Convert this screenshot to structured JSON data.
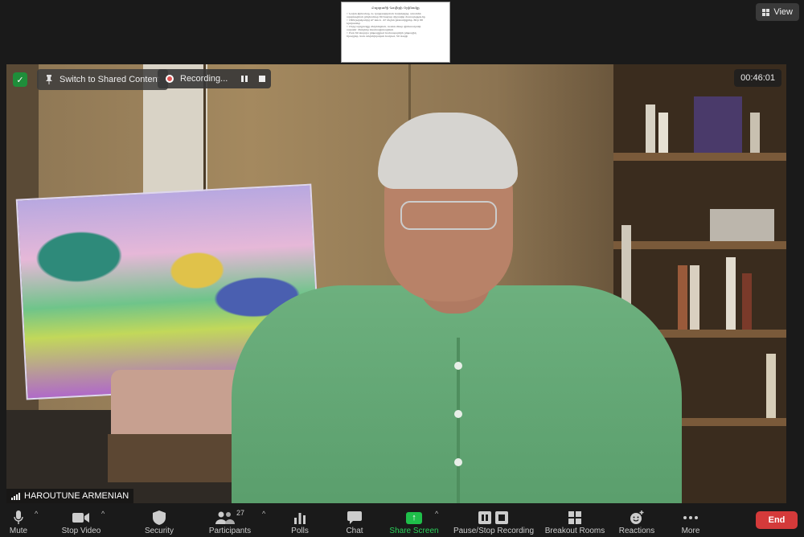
{
  "share_thumbnail": {
    "title": "Բոլորածի Գովերի Օրինակը",
    "lines": [
      "• Նախո ֆինանսը, ու կարգավորման նախորդից, ստանձն",
      "  արգտացման ընդհանուր 80 հազար միջավոր ծառայությունը",
      "• 1809 թվականից 47 տուն - 47 մեջեն ընտանիքներ, 66-ի 88",
      "  երեխաներ",
      "• 16-ից արդյունքը մեկտեղման, ուսնումնար գինեռականի",
      "  ավատն՝ ծնողներ մասնագիտացման",
      "• Ըստ 60 տարվա ընթացքում ճանապարհին ընթացիկ",
      "  ծրագրեր, նաև տեխնիկական հակում, 50 տարի"
    ]
  },
  "view_button": {
    "label": "View",
    "icon": "grid-icon"
  },
  "video": {
    "switch_button": {
      "label": "Switch to Shared Content",
      "icon": "pin-icon"
    },
    "security_badge_icon": "shield-check-icon",
    "recording": {
      "label": "Recording...",
      "pause_icon": "pause-icon",
      "stop_icon": "stop-icon"
    },
    "timer": "00:46:01",
    "participant_name": "HAROUTUNE ARMENIAN"
  },
  "toolbar": {
    "mute": {
      "label": "Mute",
      "icon": "microphone-icon"
    },
    "stop_video": {
      "label": "Stop Video",
      "icon": "camera-icon"
    },
    "security": {
      "label": "Security",
      "icon": "shield-icon"
    },
    "participants": {
      "label": "Participants",
      "icon": "people-icon",
      "count": "27"
    },
    "polls": {
      "label": "Polls",
      "icon": "bar-chart-icon"
    },
    "chat": {
      "label": "Chat",
      "icon": "chat-bubble-icon"
    },
    "share_screen": {
      "label": "Share Screen",
      "icon": "share-arrow-icon"
    },
    "pause_stop_recording": {
      "label": "Pause/Stop Recording",
      "icon": "pause-stop-icon"
    },
    "breakout_rooms": {
      "label": "Breakout Rooms",
      "icon": "grid-four-icon"
    },
    "reactions": {
      "label": "Reactions",
      "icon": "smiley-plus-icon"
    },
    "more": {
      "label": "More",
      "icon": "ellipsis-icon"
    },
    "end": {
      "label": "End"
    }
  },
  "colors": {
    "toolbar_bg": "#1a1a1a",
    "share_green": "#1fbf4a",
    "end_red": "#d43a3a",
    "recording_red": "#e05555"
  }
}
